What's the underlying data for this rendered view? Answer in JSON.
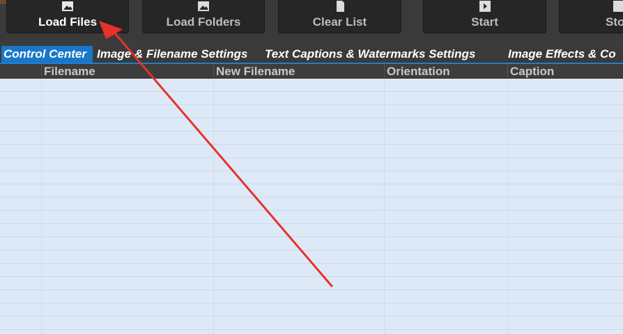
{
  "toolbar": {
    "buttons": [
      {
        "label": "Load Files",
        "icon": "image-icon"
      },
      {
        "label": "Load Folders",
        "icon": "image-icon"
      },
      {
        "label": "Clear List",
        "icon": "document-icon"
      },
      {
        "label": "Start",
        "icon": "play-icon"
      },
      {
        "label": "Sto",
        "icon": "stop-icon"
      }
    ]
  },
  "tabs": [
    {
      "label": "Control Center",
      "active": true
    },
    {
      "label": "Image & Filename Settings"
    },
    {
      "label": "Text Captions & Watermarks Settings"
    },
    {
      "label": "Image Effects & Co"
    }
  ],
  "grid": {
    "columns": [
      "",
      "Filename",
      "New Filename",
      "Orientation",
      "Caption"
    ],
    "rows": []
  },
  "colors": {
    "accent": "#1877c9",
    "grid_bg": "#dde9f7",
    "toolbar_bg": "#3a3a3a",
    "annotation_arrow": "#e8302a"
  }
}
